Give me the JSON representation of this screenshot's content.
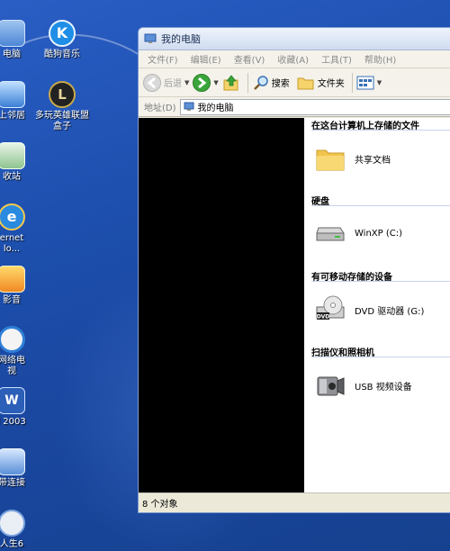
{
  "desktop": {
    "icons": [
      {
        "label": "电脑",
        "icon": "computer-icon"
      },
      {
        "label": "酷狗音乐",
        "icon": "kugou-music-icon"
      },
      {
        "label": "上邻居",
        "icon": "network-neighborhood-icon"
      },
      {
        "label": "多玩英雄联盟\n盒子",
        "icon": "lol-box-icon"
      },
      {
        "label": "收站",
        "icon": "recycle-bin-icon"
      },
      {
        "label": "ernet\nlo...",
        "icon": "internet-explorer-icon"
      },
      {
        "label": "影音",
        "icon": "media-player-icon"
      },
      {
        "label": "网络电\n视",
        "icon": "network-tv-icon"
      },
      {
        "label": "l 2003",
        "icon": "word-2003-icon"
      },
      {
        "label": "带连接",
        "icon": "broadband-connection-icon"
      },
      {
        "label": "人生6",
        "icon": "game-icon"
      }
    ]
  },
  "window": {
    "title": "我的电脑",
    "menu": [
      "文件(F)",
      "编辑(E)",
      "查看(V)",
      "收藏(A)",
      "工具(T)",
      "帮助(H)"
    ],
    "toolbar": {
      "back": "后退",
      "search": "搜索",
      "folders": "文件夹"
    },
    "address": {
      "label": "地址(D)",
      "value": "我的电脑"
    },
    "groups": [
      {
        "title": "在这台计算机上存储的文件",
        "items": [
          {
            "label": "共享文档",
            "icon": "shared-folder-icon"
          }
        ]
      },
      {
        "title": "硬盘",
        "items": [
          {
            "label": "WinXP (C:)",
            "icon": "hard-drive-icon"
          }
        ]
      },
      {
        "title": "有可移动存储的设备",
        "items": [
          {
            "label": "DVD 驱动器 (G:)",
            "icon": "dvd-drive-icon"
          }
        ]
      },
      {
        "title": "扫描仪和照相机",
        "items": [
          {
            "label": "USB 视频设备",
            "icon": "usb-camera-icon"
          }
        ]
      }
    ],
    "status": "8 个对象"
  }
}
